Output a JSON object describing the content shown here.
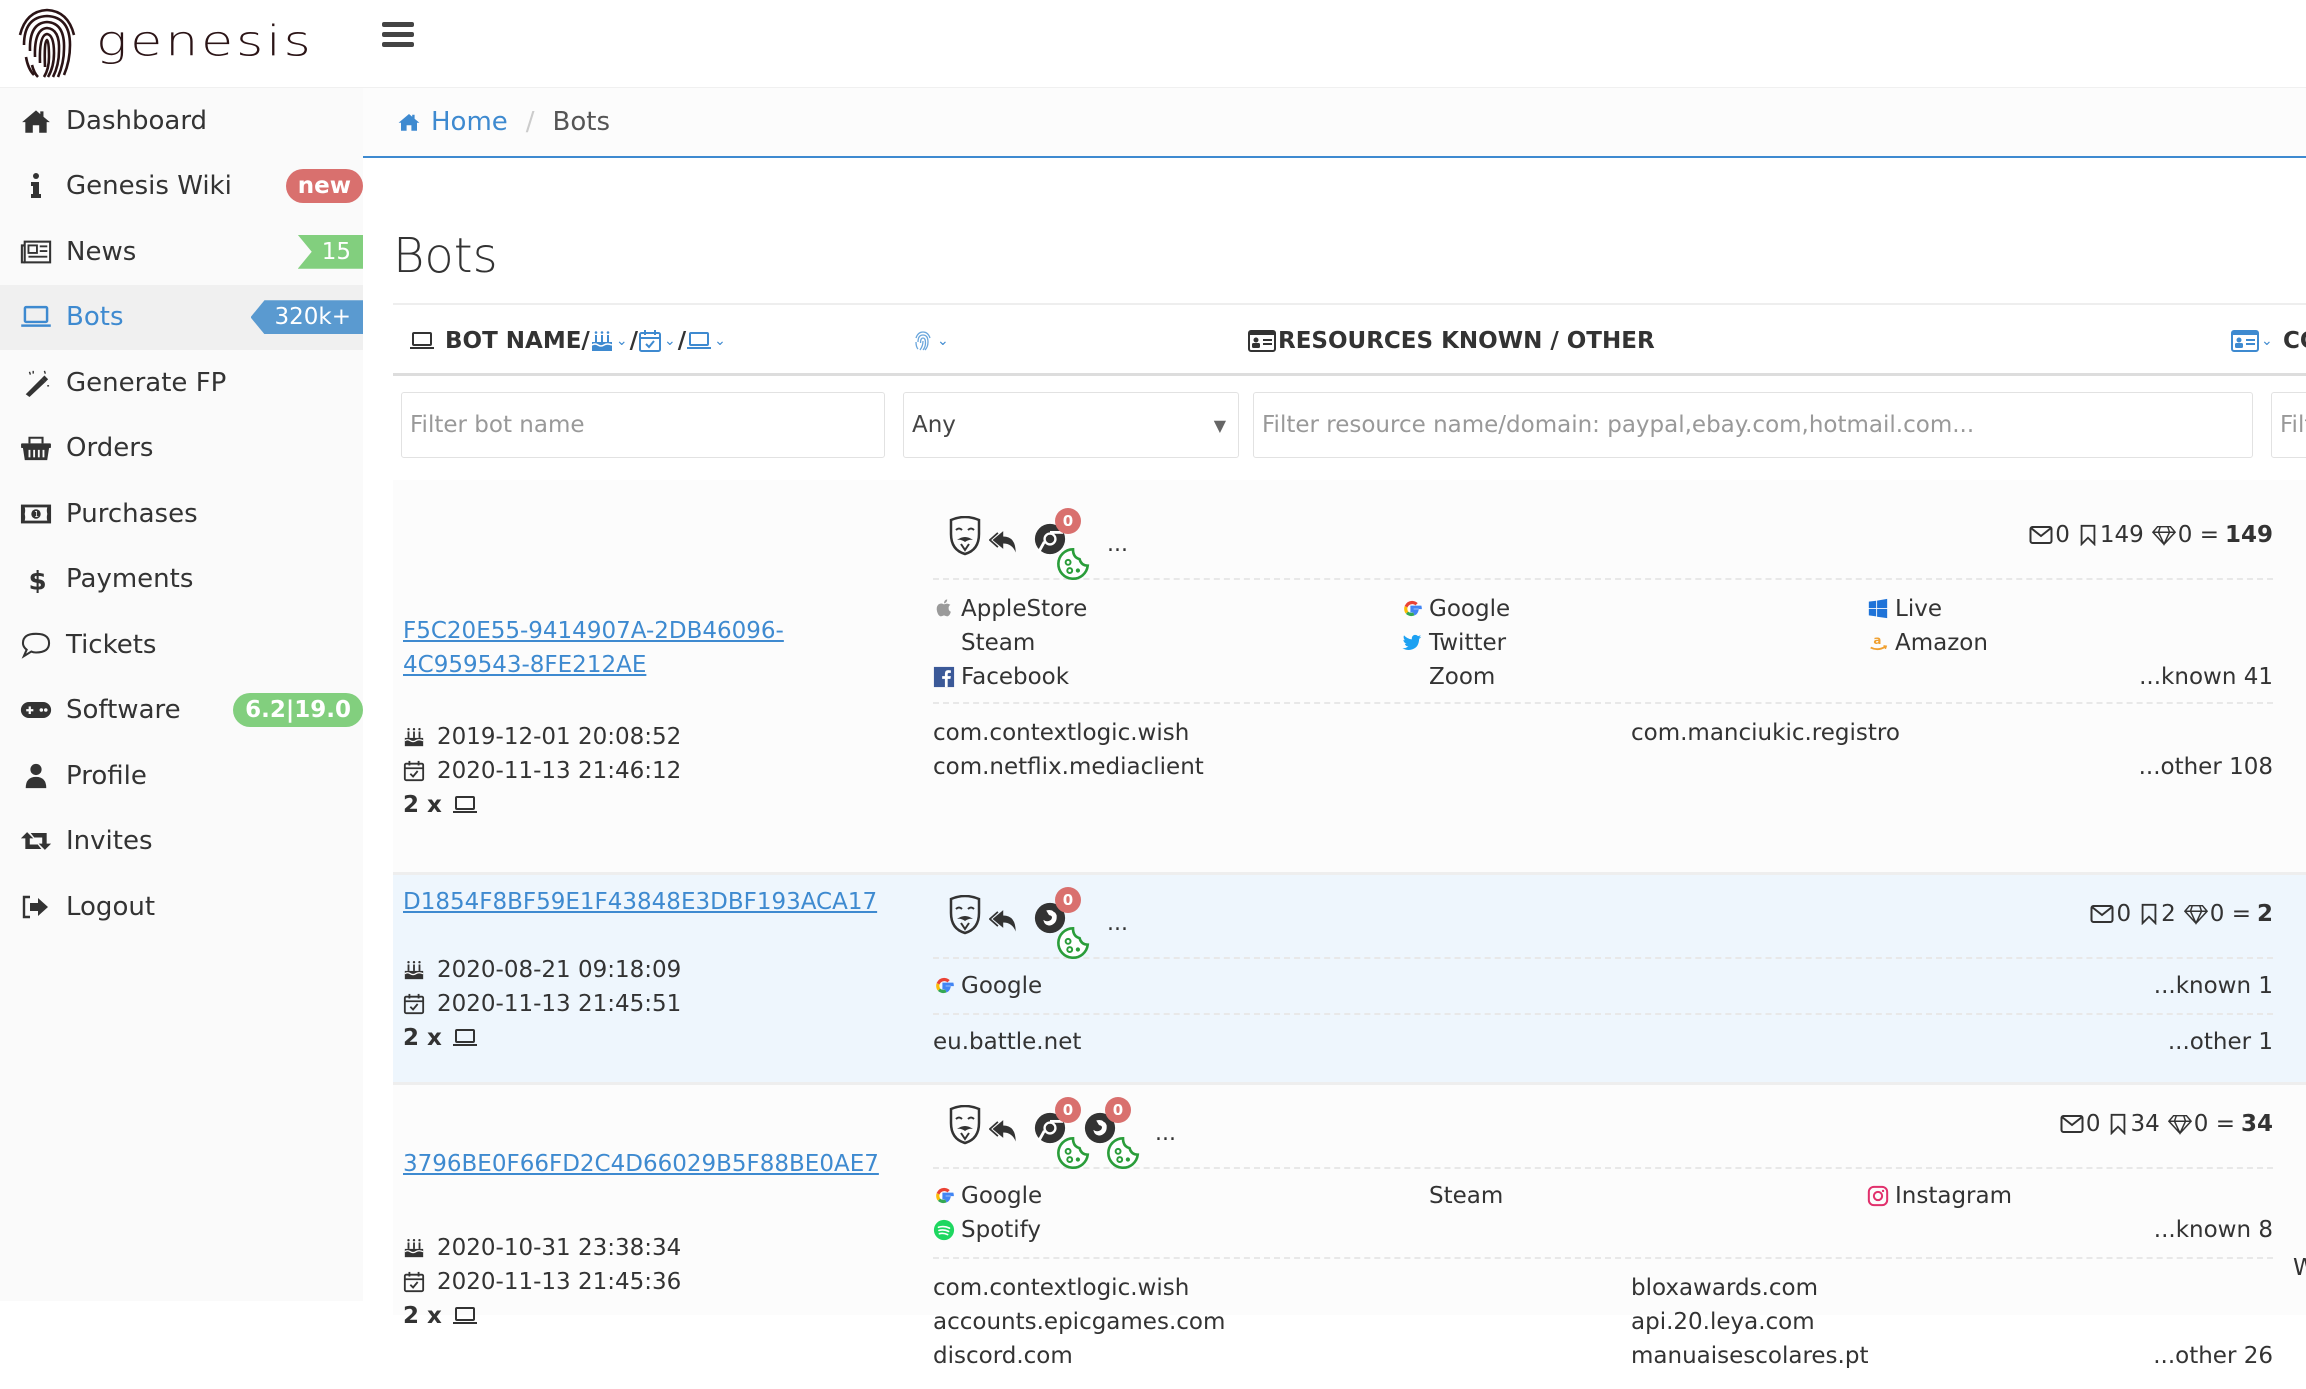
{
  "brand": {
    "name": "genesis"
  },
  "sidebar": {
    "items": [
      {
        "label": "Dashboard",
        "icon": "home-icon"
      },
      {
        "label": "Genesis Wiki",
        "icon": "info-icon",
        "badge": "new"
      },
      {
        "label": "News",
        "icon": "newspaper-icon",
        "badge": "15"
      },
      {
        "label": "Bots",
        "icon": "laptop-icon",
        "badge": "320k+",
        "active": true
      },
      {
        "label": "Generate FP",
        "icon": "magic-wand-icon"
      },
      {
        "label": "Orders",
        "icon": "basket-icon"
      },
      {
        "label": "Purchases",
        "icon": "money-icon"
      },
      {
        "label": "Payments",
        "icon": "dollar-icon"
      },
      {
        "label": "Tickets",
        "icon": "comment-icon"
      },
      {
        "label": "Software",
        "icon": "gamepad-icon",
        "badge": "6.2|19.0"
      },
      {
        "label": "Profile",
        "icon": "user-icon"
      },
      {
        "label": "Invites",
        "icon": "retweet-icon"
      },
      {
        "label": "Logout",
        "icon": "sign-out-icon"
      }
    ]
  },
  "breadcrumb": {
    "home": "Home",
    "separator": "/",
    "current": "Bots"
  },
  "page": {
    "title": "Bots"
  },
  "table": {
    "headers": {
      "bot_name": "BOT NAME/",
      "slash": "/",
      "resources": "RESOURCES KNOWN / OTHER",
      "next": "CC"
    },
    "filters": {
      "bot_name_placeholder": "Filter bot name",
      "fingerprint_select": "Any",
      "resource_placeholder": "Filter resource name/domain: paypal,ebay.com,hotmail.com...",
      "next_placeholder": "Filt"
    },
    "rows": [
      {
        "bot_name": [
          "F5C20E55-9414907A-2DB46096-",
          "4C959543-8FE212AE"
        ],
        "created": "2019-12-01 20:08:52",
        "updated": "2020-11-13 21:46:12",
        "devices": "2 x",
        "browsers": [
          {
            "type": "chrome",
            "count": "0"
          }
        ],
        "more": "...",
        "stats": {
          "mail": "0",
          "bookmarks": "149",
          "gems": "0",
          "eq": "=",
          "total": "149"
        },
        "known": [
          {
            "name": "AppleStore",
            "icon": "apple-icon"
          },
          {
            "name": "Google",
            "icon": "google-icon"
          },
          {
            "name": "Live",
            "icon": "windows-icon"
          },
          {
            "name": "Steam",
            "icon": ""
          },
          {
            "name": "Twitter",
            "icon": "twitter-icon"
          },
          {
            "name": "Amazon",
            "icon": "amazon-icon"
          },
          {
            "name": "Facebook",
            "icon": "facebook-icon"
          },
          {
            "name": "Zoom",
            "icon": ""
          }
        ],
        "known_more": "...known 41",
        "other": [
          "com.contextlogic.wish",
          "com.manciukic.registro",
          "com.netflix.mediaclient"
        ],
        "other_more": "...other 108"
      },
      {
        "bot_name": [
          "D1854F8BF59E1F43848E3DBF193ACA17"
        ],
        "created": "2020-08-21 09:18:09",
        "updated": "2020-11-13 21:45:51",
        "devices": "2 x",
        "browsers": [
          {
            "type": "firefox",
            "count": "0"
          }
        ],
        "more": "...",
        "stats": {
          "mail": "0",
          "bookmarks": "2",
          "gems": "0",
          "eq": "=",
          "total": "2"
        },
        "known": [
          {
            "name": "Google",
            "icon": "google-icon"
          }
        ],
        "known_more": "...known 1",
        "other": [
          "eu.battle.net"
        ],
        "other_more": "...other 1"
      },
      {
        "bot_name": [
          "3796BE0F66FD2C4D66029B5F88BE0AE7"
        ],
        "created": "2020-10-31 23:38:34",
        "updated": "2020-11-13 21:45:36",
        "devices": "2 x",
        "browsers": [
          {
            "type": "chrome",
            "count": "0"
          },
          {
            "type": "firefox",
            "count": "0"
          }
        ],
        "more": "...",
        "stats": {
          "mail": "0",
          "bookmarks": "34",
          "gems": "0",
          "eq": "=",
          "total": "34"
        },
        "known": [
          {
            "name": "Google",
            "icon": "google-icon"
          },
          {
            "name": "Steam",
            "icon": ""
          },
          {
            "name": "Instagram",
            "icon": "instagram-icon"
          },
          {
            "name": "Spotify",
            "icon": "spotify-icon"
          }
        ],
        "known_more": "...known 8",
        "other": [
          "com.contextlogic.wish",
          "bloxawards.com",
          "accounts.epicgames.com",
          "api.20.leya.com",
          "discord.com",
          "manuaisescolares.pt"
        ],
        "other_more": "...other 26",
        "clipped_right": "W"
      }
    ]
  },
  "colors": {
    "accent": "#3e8ad0",
    "badge_red": "#d9706e",
    "badge_green": "#82cf7e",
    "badge_blue": "#5a9ad0",
    "row_alt": "#eef6fd"
  }
}
